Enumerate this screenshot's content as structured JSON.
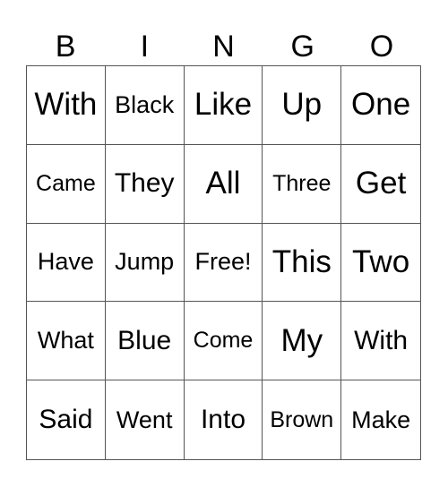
{
  "header": [
    "B",
    "I",
    "N",
    "G",
    "O"
  ],
  "cells": [
    [
      "With",
      "Black",
      "Like",
      "Up",
      "One"
    ],
    [
      "Came",
      "They",
      "All",
      "Three",
      "Get"
    ],
    [
      "Have",
      "Jump",
      "Free!",
      "This",
      "Two"
    ],
    [
      "What",
      "Blue",
      "Come",
      "My",
      "With"
    ],
    [
      "Said",
      "Went",
      "Into",
      "Brown",
      "Make"
    ]
  ]
}
